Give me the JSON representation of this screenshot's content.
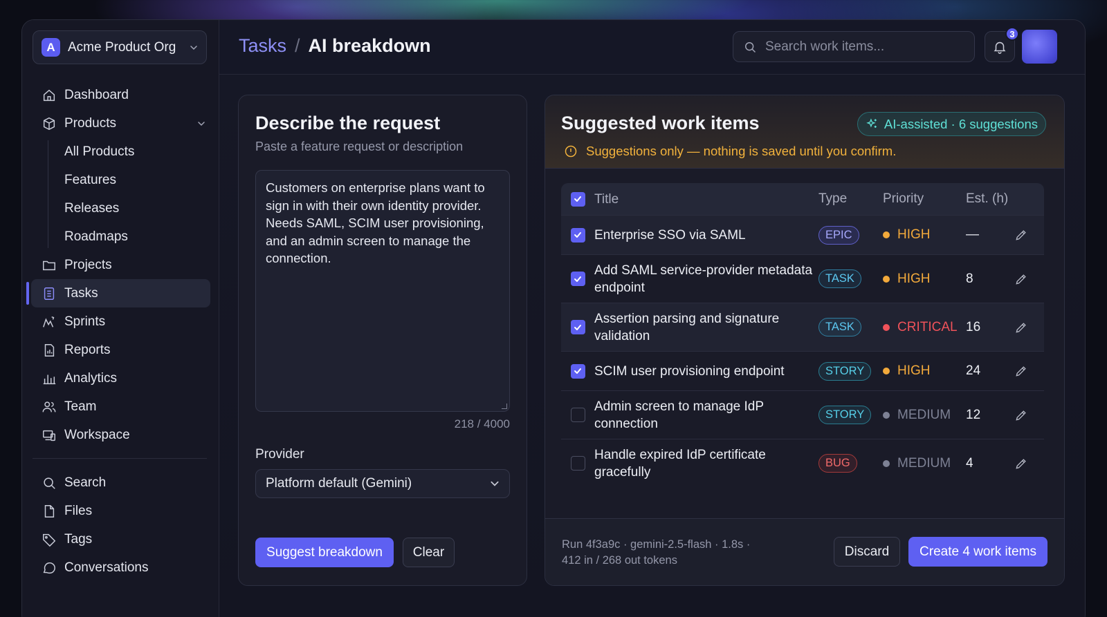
{
  "org": {
    "initial": "A",
    "name": "Acme Product Org"
  },
  "nav": {
    "dashboard": "Dashboard",
    "products": "Products",
    "products_sub": [
      "All Products",
      "Features",
      "Releases",
      "Roadmaps"
    ],
    "projects": "Projects",
    "tasks": "Tasks",
    "sprints": "Sprints",
    "reports": "Reports",
    "analytics": "Analytics",
    "team": "Team",
    "workspace": "Workspace",
    "search": "Search",
    "files": "Files",
    "tags": "Tags",
    "conversations": "Conversations"
  },
  "header": {
    "crumb_parent": "Tasks",
    "crumb_sep": "/",
    "crumb_current": "AI breakdown",
    "search_placeholder": "Search work items...",
    "notifications": "3"
  },
  "request": {
    "title": "Describe the request",
    "subtitle": "Paste a feature request or description",
    "text": "Customers on enterprise plans want to sign in with their own identity provider. Needs SAML, SCIM user provisioning, and an admin screen to manage the connection.",
    "char_count": "218 / 4000",
    "provider_label": "Provider",
    "provider_value": "Platform default (Gemini)",
    "suggest_label": "Suggest breakdown",
    "clear_label": "Clear"
  },
  "suggestions": {
    "title": "Suggested work items",
    "ai_badge": "AI-assisted · 6 suggestions",
    "warning": "Suggestions only — nothing is saved until you confirm.",
    "columns": {
      "title": "Title",
      "type": "Type",
      "priority": "Priority",
      "est": "Est. (h)"
    },
    "rows": [
      {
        "title": "Enterprise SSO via SAML",
        "type": "EPIC",
        "priority": "HIGH",
        "est": "—",
        "checked": true
      },
      {
        "title": "Add SAML service-provider metadata endpoint",
        "type": "TASK",
        "priority": "HIGH",
        "est": "8",
        "checked": true
      },
      {
        "title": "Assertion parsing and signature validation",
        "type": "TASK",
        "priority": "CRITICAL",
        "est": "16",
        "checked": true
      },
      {
        "title": "SCIM user provisioning endpoint",
        "type": "STORY",
        "priority": "HIGH",
        "est": "24",
        "checked": true
      },
      {
        "title": "Admin screen to manage IdP connection",
        "type": "STORY",
        "priority": "MEDIUM",
        "est": "12",
        "checked": false
      },
      {
        "title": "Handle expired IdP certificate gracefully",
        "type": "BUG",
        "priority": "MEDIUM",
        "est": "4",
        "checked": false
      }
    ],
    "run_info_line1": "Run 4f3a9c · gemini-2.5-flash · 1.8s ·",
    "run_info_line2": "412 in / 268 out tokens",
    "discard_label": "Discard",
    "create_label": "Create 4 work items"
  },
  "colors": {
    "accent": "#5e60f2",
    "high": "#f2a93b",
    "critical": "#f0525a",
    "medium": "#7d8194",
    "ai": "#5fe0d6",
    "warning": "#f2b23c"
  }
}
